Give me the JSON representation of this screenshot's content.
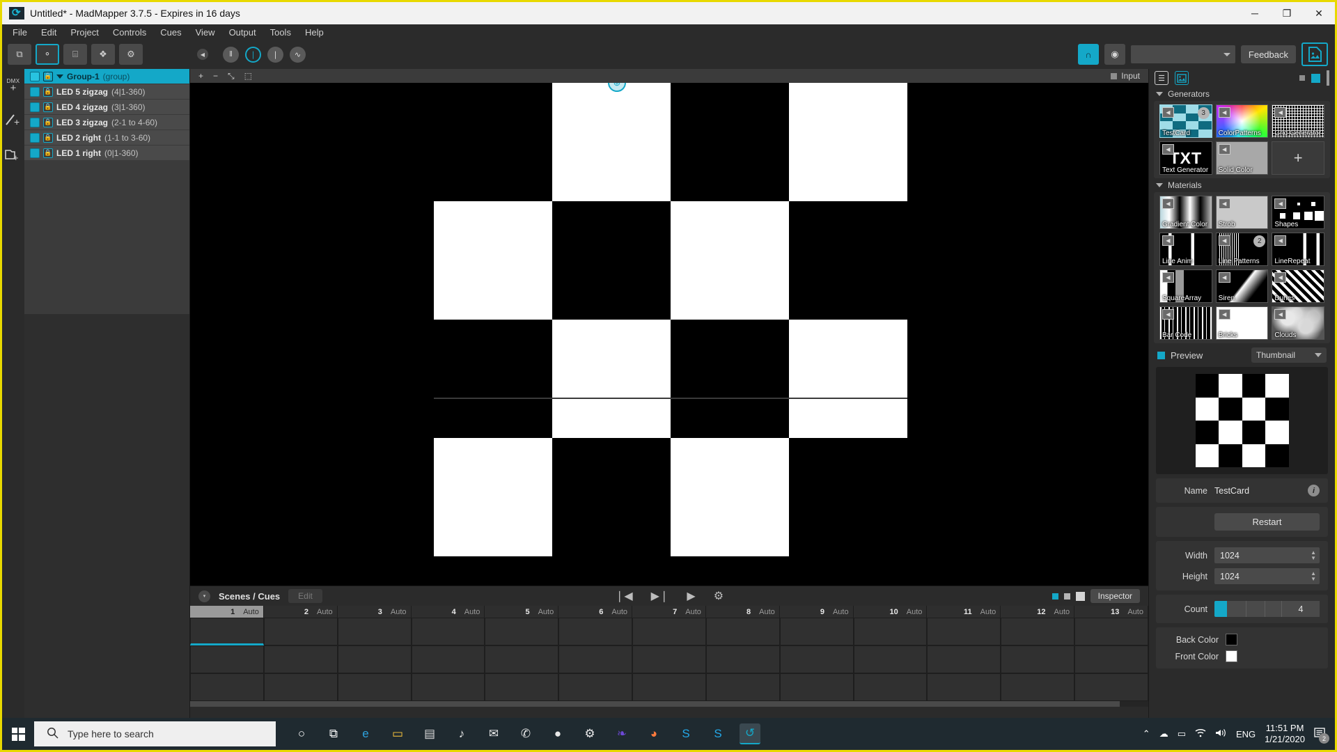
{
  "window": {
    "title": "Untitled* - MadMapper 3.7.5 - Expires in 16 days",
    "minimize": "─",
    "maximize": "❐",
    "close": "✕"
  },
  "menu": [
    "File",
    "Edit",
    "Project",
    "Controls",
    "Cues",
    "View",
    "Output",
    "Tools",
    "Help"
  ],
  "toolbar": {
    "buttons": [
      {
        "name": "surfaces-tool",
        "glyph": "⧉"
      },
      {
        "name": "fixtures-tool",
        "glyph": "⚬"
      },
      {
        "name": "dmx-tool",
        "glyph": "⌸"
      },
      {
        "name": "modules-tool",
        "glyph": "❖"
      },
      {
        "name": "settings-tool",
        "glyph": "⚙"
      }
    ],
    "transport": [
      {
        "name": "pause-button",
        "glyph": "‖"
      },
      {
        "name": "bpm-button",
        "glyph": "❘"
      },
      {
        "name": "tap-button",
        "glyph": "❘"
      },
      {
        "name": "curve-button",
        "glyph": "∿"
      }
    ],
    "snap_label": "∩",
    "preview_label": "◉",
    "output_select_value": "",
    "feedback_label": "Feedback",
    "media_label": "Ὓb"
  },
  "rail": {
    "dmx_label": "DMX",
    "items": [
      {
        "name": "add-dmx-fixture",
        "glyph": "+"
      },
      {
        "name": "add-line-fixture",
        "glyph": "+"
      },
      {
        "name": "add-group-folder",
        "glyph": "+"
      }
    ]
  },
  "layers": {
    "rows": [
      {
        "name": "Group-1",
        "sub": "(group)",
        "group": true
      },
      {
        "name": "LED 5 zigzag",
        "sub": "(4|1-360)",
        "group": false
      },
      {
        "name": "LED 4 zigzag",
        "sub": "(3|1-360)",
        "group": false
      },
      {
        "name": "LED 3 zigzag",
        "sub": "(2-1 to 4-60)",
        "group": false
      },
      {
        "name": "LED 2 right",
        "sub": "(1-1 to 3-60)",
        "group": false
      },
      {
        "name": "LED 1 right",
        "sub": "(0|1-360)",
        "group": false
      }
    ]
  },
  "canvas": {
    "zoom_in": "+",
    "zoom_out": "−",
    "fit": "⤡",
    "select": "⬚",
    "input_label": "Input",
    "input_marker": "■",
    "handle_glyph": "⊕",
    "checker": {
      "rows": 4,
      "cols": 4,
      "back_color": "#000000",
      "front_color": "#ffffff"
    }
  },
  "cues": {
    "collapse_glyph": "▾",
    "title": "Scenes / Cues",
    "edit_label": "Edit",
    "prev_glyph": "❘◀",
    "next_glyph": "▶❘",
    "play_glyph": "▶",
    "gear_glyph": "⚙",
    "inspector_label": "Inspector",
    "columns": [
      {
        "num": "1",
        "mode": "Auto",
        "active": true
      },
      {
        "num": "2",
        "mode": "Auto",
        "active": false
      },
      {
        "num": "3",
        "mode": "Auto",
        "active": false
      },
      {
        "num": "4",
        "mode": "Auto",
        "active": false
      },
      {
        "num": "5",
        "mode": "Auto",
        "active": false
      },
      {
        "num": "6",
        "mode": "Auto",
        "active": false
      },
      {
        "num": "7",
        "mode": "Auto",
        "active": false
      },
      {
        "num": "8",
        "mode": "Auto",
        "active": false
      },
      {
        "num": "9",
        "mode": "Auto",
        "active": false
      },
      {
        "num": "10",
        "mode": "Auto",
        "active": false
      },
      {
        "num": "11",
        "mode": "Auto",
        "active": false
      },
      {
        "num": "12",
        "mode": "Auto",
        "active": false
      },
      {
        "num": "13",
        "mode": "Auto",
        "active": false
      }
    ],
    "row_count": 3
  },
  "right_panel": {
    "list_icon": "☰",
    "media_icon": "⛰",
    "generators": {
      "title": "Generators",
      "items": [
        {
          "label": "TestCard",
          "badge": "3",
          "style": "testcard",
          "selected": true
        },
        {
          "label": "ColorPatterns",
          "badge": "",
          "style": "rainbow",
          "selected": false
        },
        {
          "label": "Grid Generator",
          "badge": "",
          "style": "gridgen",
          "selected": false
        },
        {
          "label": "Text Generator",
          "badge": "",
          "style": "txt",
          "selected": false
        },
        {
          "label": "Solid Color",
          "badge": "",
          "style": "solid",
          "selected": false
        },
        {
          "label": "",
          "badge": "",
          "style": "add",
          "selected": false
        }
      ],
      "add_glyph": "+"
    },
    "materials": {
      "title": "Materials",
      "items": [
        {
          "label": "Gradient Color",
          "badge": "",
          "style": "grad"
        },
        {
          "label": "Strob",
          "badge": "",
          "style": "strob"
        },
        {
          "label": "Shapes",
          "badge": "",
          "style": "shapes"
        },
        {
          "label": "Line Anim",
          "badge": "",
          "style": "lineanim"
        },
        {
          "label": "Line Patterns",
          "badge": "2",
          "style": "linepat"
        },
        {
          "label": "LineRepeat",
          "badge": "",
          "style": "linerep"
        },
        {
          "label": "SquareArray",
          "badge": "",
          "style": "sqarr"
        },
        {
          "label": "Siren",
          "badge": "",
          "style": "siren"
        },
        {
          "label": "Dunes",
          "badge": "",
          "style": "dune"
        },
        {
          "label": "Bar Code",
          "badge": "",
          "style": "barcode"
        },
        {
          "label": "Bricks",
          "badge": "",
          "style": "bricks"
        },
        {
          "label": "Clouds",
          "badge": "",
          "style": "clouds"
        }
      ]
    },
    "preview": {
      "title": "Preview",
      "mode": "Thumbnail",
      "caret": "▾"
    },
    "properties": {
      "name_label": "Name",
      "name_value": "TestCard",
      "info_glyph": "i",
      "restart_label": "Restart",
      "width_label": "Width",
      "width_value": "1024",
      "height_label": "Height",
      "height_value": "1024",
      "count_label": "Count",
      "count_value": "4",
      "back_color_label": "Back Color",
      "back_color": "#000000",
      "front_color_label": "Front Color",
      "front_color": "#ffffff"
    }
  },
  "taskbar": {
    "search_placeholder": "Type here to search",
    "search_icon": "⚲",
    "apps": [
      {
        "name": "cortana-icon",
        "glyph": "○"
      },
      {
        "name": "task-view-icon",
        "glyph": "⧉"
      },
      {
        "name": "edge-icon",
        "glyph": "e"
      },
      {
        "name": "file-explorer-icon",
        "glyph": "▭"
      },
      {
        "name": "store-icon",
        "glyph": "▤"
      },
      {
        "name": "music-icon",
        "glyph": "♪"
      },
      {
        "name": "mail-icon",
        "glyph": "✉"
      },
      {
        "name": "whatsapp-icon",
        "glyph": "✆"
      },
      {
        "name": "chrome-icon",
        "glyph": "●"
      },
      {
        "name": "settings-icon",
        "glyph": "⚙"
      },
      {
        "name": "twitter-icon",
        "glyph": "❧"
      },
      {
        "name": "reddit-icon",
        "glyph": "◕"
      },
      {
        "name": "skype-icon",
        "glyph": "S"
      },
      {
        "name": "skype-business-icon",
        "glyph": "S"
      },
      {
        "name": "madmapper-icon",
        "glyph": "↺"
      }
    ],
    "tray": [
      {
        "name": "show-hidden-icons",
        "glyph": "⌃"
      },
      {
        "name": "onedrive-icon",
        "glyph": "☁"
      },
      {
        "name": "battery-icon",
        "glyph": "▭"
      },
      {
        "name": "wifi-icon",
        "glyph": "◠"
      },
      {
        "name": "volume-icon",
        "glyph": "ὐa"
      }
    ],
    "language": "ENG",
    "time": "11:51 PM",
    "date": "1/21/2020",
    "notification_count": "2"
  }
}
